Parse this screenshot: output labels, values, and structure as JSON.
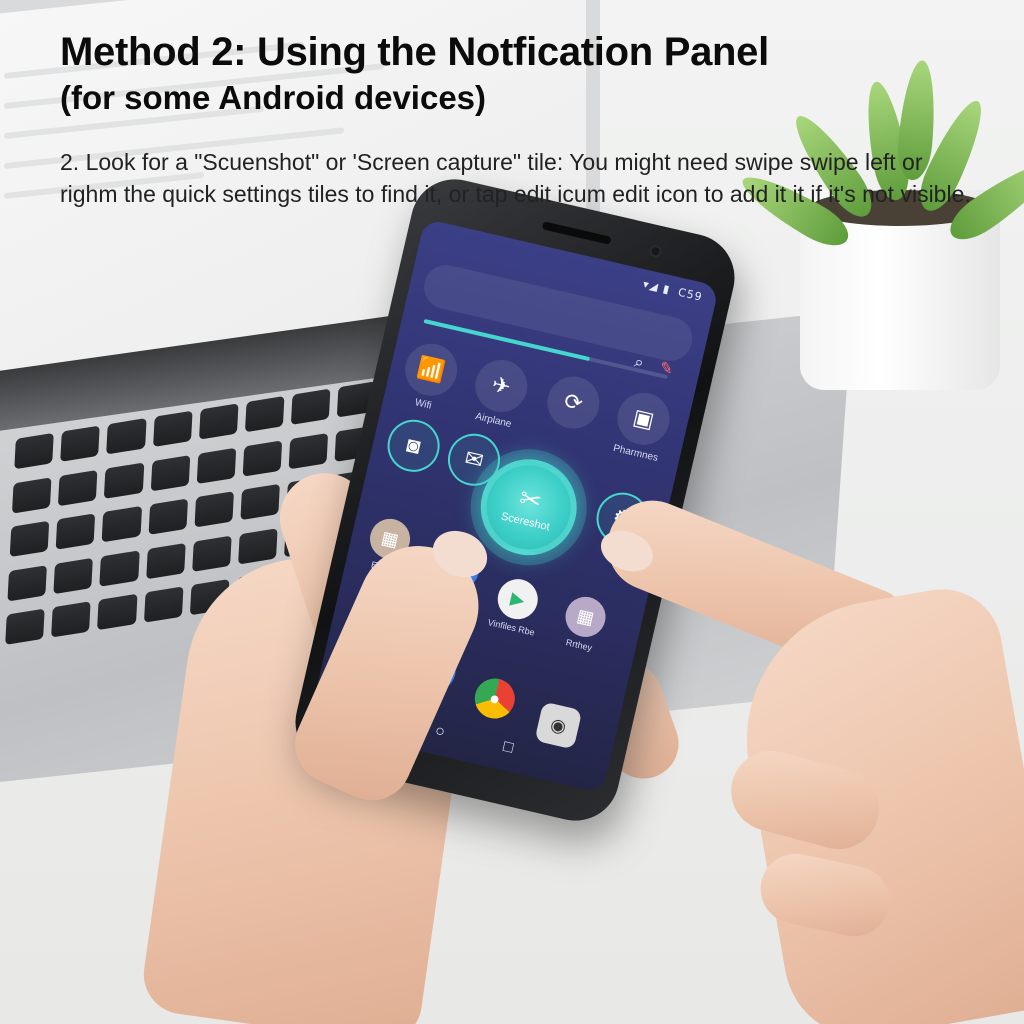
{
  "heading": {
    "title": "Method 2: Using the Notfication Panel",
    "subtitle": "(for some Android devices)",
    "body": "2. Look for a \"Scuenshot\" or 'Screen capture\" tile: You might need swipe swipe left or righm the quick settings tiles to find it, or tap edit icum edit icon to add it it if it's not visible."
  },
  "phone": {
    "status_text": "C59",
    "status_icons": "▾◢ ▮",
    "tiles": [
      {
        "label": "Wifi",
        "icon": "wifi-icon",
        "glyph": "📶"
      },
      {
        "label": "Airplane",
        "icon": "airplane-icon",
        "glyph": "✈"
      },
      {
        "label": "",
        "icon": "rotate-icon",
        "glyph": "⟳"
      },
      {
        "label": "Pharmnes",
        "icon": "cast-icon",
        "glyph": "▣"
      },
      {
        "label": "",
        "icon": "screen-record-icon",
        "glyph": "◙"
      },
      {
        "label": "",
        "icon": "mail-icon",
        "glyph": "✉"
      },
      {
        "label": "",
        "icon": "settings-icon",
        "glyph": "⚙"
      }
    ],
    "screenshot_tile": {
      "label": "Scereshot",
      "icon": "scissors-icon",
      "glyph": "✂"
    },
    "apps": [
      {
        "label": "Eoves",
        "icon": "apps-folder-icon",
        "color": "#c8b3a3"
      },
      {
        "label": "r",
        "icon": "app-icon",
        "color": "#3d7be6"
      },
      {
        "label": "Vinfiles Rbe",
        "icon": "play-store-icon",
        "color": "#f1f1f1"
      },
      {
        "label": "Rrthey",
        "icon": "apps-folder-icon",
        "color": "#b9a9c8"
      }
    ],
    "dock": [
      {
        "icon": "phone-icon",
        "color": "#2fa84f"
      },
      {
        "icon": "messages-icon",
        "color": "#3a7be0"
      },
      {
        "icon": "chrome-icon",
        "color": "#e8e8e8"
      },
      {
        "icon": "camera-icon",
        "color": "#d9d9d9"
      }
    ],
    "dock_label": "E",
    "nav": {
      "home": "○",
      "recent": "□"
    }
  },
  "colors": {
    "accent": "#45d6d0",
    "screen_top": "#3b3f86",
    "screen_bottom": "#232546",
    "text": "#0b0b0b"
  }
}
